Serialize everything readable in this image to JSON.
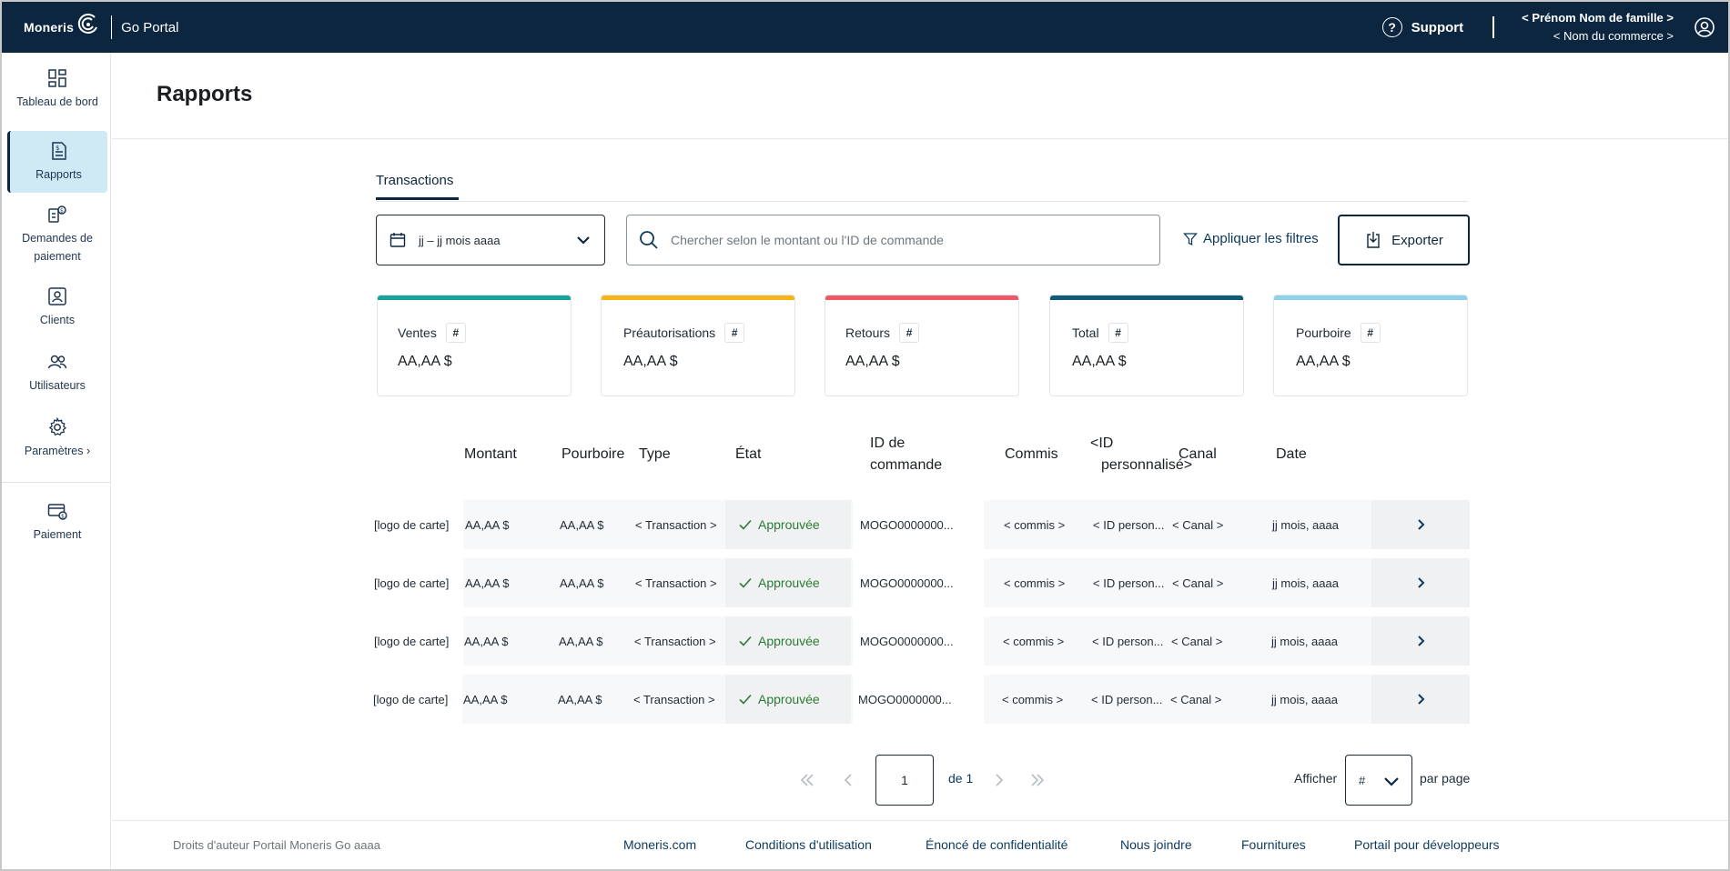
{
  "header": {
    "brand": "Moneris",
    "portal": "Go Portal",
    "support": "Support",
    "user_name": "< Prénom Nom de famille >",
    "merchant_name": "< Nom du commerce >"
  },
  "sidebar": {
    "items": [
      {
        "label": "Tableau de bord"
      },
      {
        "label": "Rapports"
      },
      {
        "label": "Demandes de paiement"
      },
      {
        "label": "Clients"
      },
      {
        "label": "Utilisateurs"
      },
      {
        "label": "Paramètres ›"
      },
      {
        "label": "Paiement"
      }
    ]
  },
  "page": {
    "title": "Rapports",
    "tab": "Transactions"
  },
  "toolbar": {
    "date_range": "jj – jj mois aaaa",
    "search_placeholder": "Chercher selon le montant ou l'ID de commande",
    "filters": "Appliquer les filtres",
    "export": "Exporter"
  },
  "cards": [
    {
      "label": "Ventes",
      "count": "#",
      "value": "AA,AA $",
      "color": "#1aa39a"
    },
    {
      "label": "Préautorisations",
      "count": "#",
      "value": "AA,AA $",
      "color": "#f5b51a"
    },
    {
      "label": "Retours",
      "count": "#",
      "value": "AA,AA $",
      "color": "#ef5866"
    },
    {
      "label": "Total",
      "count": "#",
      "value": "AA,AA $",
      "color": "#0f5b78"
    },
    {
      "label": "Pourboire",
      "count": "#",
      "value": "AA,AA $",
      "color": "#8fd0ea"
    }
  ],
  "table": {
    "headers": {
      "amount": "Montant",
      "tip": "Pourboire",
      "type": "Type",
      "state": "État",
      "order_id_1": "ID de",
      "order_id_2": "commande",
      "clerk": "Commis",
      "custom_id_1": "<ID",
      "custom_id_2": "personnalisé>",
      "channel": "Canal",
      "date": "Date"
    },
    "rows": [
      {
        "card": "[logo de carte]",
        "amount": "AA,AA $",
        "tip": "AA,AA $",
        "type": "< Transaction >",
        "state": "Approuvée",
        "order": "MOGO0000000...",
        "clerk": "< commis >",
        "custom": "< ID person...",
        "channel": "< Canal >",
        "date": "jj mois, aaaa"
      },
      {
        "card": "[logo de carte]",
        "amount": "AA,AA $",
        "tip": "AA,AA $",
        "type": "< Transaction >",
        "state": "Approuvée",
        "order": "MOGO0000000...",
        "clerk": "< commis >",
        "custom": "< ID person...",
        "channel": "< Canal >",
        "date": "jj mois, aaaa"
      },
      {
        "card": "[logo de carte]",
        "amount": "AA,AA $",
        "tip": "AA,AA $",
        "type": "< Transaction >",
        "state": "Approuvée",
        "order": "MOGO0000000...",
        "clerk": "< commis >",
        "custom": "< ID person...",
        "channel": "< Canal >",
        "date": "jj mois, aaaa"
      },
      {
        "card": "[logo de carte]",
        "amount": "AA,AA $",
        "tip": "AA,AA $",
        "type": "< Transaction >",
        "state": "Approuvée",
        "order": "MOGO0000000...",
        "clerk": "< commis >",
        "custom": "< ID person...",
        "channel": "< Canal >",
        "date": "jj mois, aaaa"
      }
    ]
  },
  "pagination": {
    "current": "1",
    "of": "de 1",
    "show": "Afficher",
    "per_value": "#",
    "per_page": "par page"
  },
  "footer": {
    "copyright": "Droits d'auteur Portail Moneris Go  aaaa",
    "links": [
      "Moneris.com",
      "Conditions d'utilisation",
      "Énoncé de confidentialité",
      "Nous joindre",
      "Fournitures",
      "Portail pour développeurs"
    ]
  }
}
